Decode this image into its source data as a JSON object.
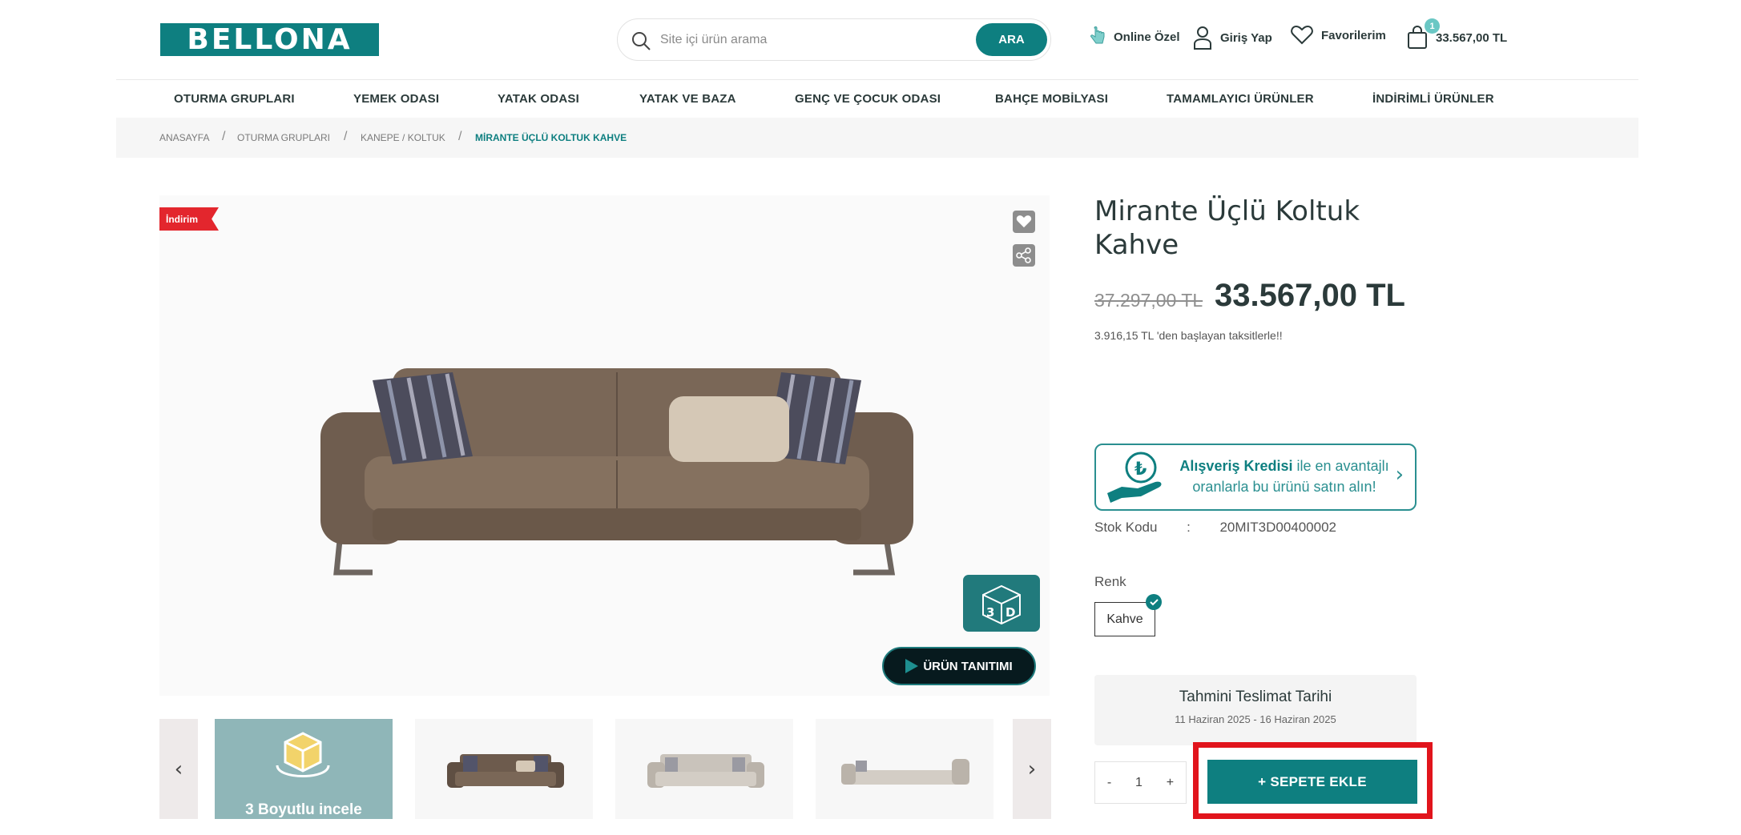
{
  "header": {
    "logo": "BELLONA",
    "search_placeholder": "Site içi ürün arama",
    "search_button": "ARA",
    "online_ozel": "Online Özel",
    "login": "Giriş Yap",
    "favorites": "Favorilerim",
    "cart_count": "1",
    "cart_total": "33.567,00 TL"
  },
  "nav": [
    "OTURMA GRUPLARI",
    "YEMEK ODASI",
    "YATAK ODASI",
    "YATAK VE BAZA",
    "GENÇ VE ÇOCUK ODASI",
    "BAHÇE MOBİLYASI",
    "TAMAMLAYICI ÜRÜNLER",
    "İNDİRİMLİ ÜRÜNLER"
  ],
  "breadcrumb": [
    "ANASAYFA",
    "OTURMA GRUPLARI",
    "KANEPE / KOLTUK",
    "MİRANTE ÜÇLÜ KOLTUK KAHVE"
  ],
  "gallery": {
    "discount_tag": "İndirim",
    "intro_button": "ÜRÜN TANITIMI",
    "thumb_3d_label": "3 Boyutlu incele",
    "colors": {
      "sofa": "#7d6a5a",
      "accent": "#0e7f80"
    }
  },
  "product": {
    "title": "Mirante Üçlü Koltuk Kahve",
    "old_price": "37.297,00 TL",
    "new_price": "33.567,00 TL",
    "installment": "3.916,15 TL 'den başlayan taksitlerle!!",
    "credit_bold": "Alışveriş Kredisi",
    "credit_rest": " ile en avantajlı oranlarla bu ürünü satın alın!",
    "stock_label": "Stok Kodu",
    "stock_code": "20MIT3D00400002",
    "color_label": "Renk",
    "color_option": "Kahve",
    "delivery_title": "Tahmini Teslimat Tarihi",
    "delivery_dates": "11 Haziran 2025 - 16 Haziran 2025",
    "qty_minus": "-",
    "qty_value": "1",
    "qty_plus": "+",
    "add_to_cart": "+ SEPETE EKLE"
  }
}
